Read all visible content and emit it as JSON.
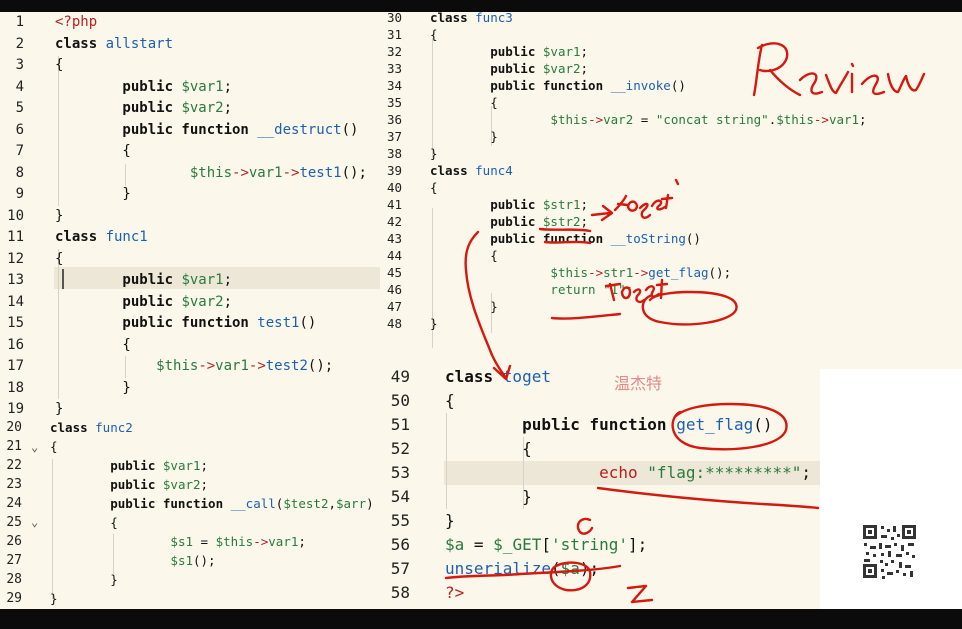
{
  "editor": {
    "panel1": {
      "lines": [
        {
          "n": "1",
          "tokens": [
            {
              "t": "<?php",
              "c": "tag"
            }
          ]
        },
        {
          "n": "2",
          "tokens": [
            {
              "t": "class ",
              "c": "kw"
            },
            {
              "t": "allstart",
              "c": "cls"
            }
          ]
        },
        {
          "n": "3",
          "tokens": [
            {
              "t": "{",
              "c": "plain"
            }
          ]
        },
        {
          "n": "4",
          "tokens": [
            {
              "t": "        public ",
              "c": "kw"
            },
            {
              "t": "$var1",
              "c": "var"
            },
            {
              "t": ";",
              "c": "plain"
            }
          ]
        },
        {
          "n": "5",
          "tokens": [
            {
              "t": "        public ",
              "c": "kw"
            },
            {
              "t": "$var2",
              "c": "var"
            },
            {
              "t": ";",
              "c": "plain"
            }
          ]
        },
        {
          "n": "6",
          "tokens": [
            {
              "t": "        public function ",
              "c": "kw"
            },
            {
              "t": "__destruct",
              "c": "fn"
            },
            {
              "t": "()",
              "c": "plain"
            }
          ]
        },
        {
          "n": "7",
          "tokens": [
            {
              "t": "        {",
              "c": "plain"
            }
          ]
        },
        {
          "n": "8",
          "tokens": [
            {
              "t": "                ",
              "c": "plain"
            },
            {
              "t": "$this",
              "c": "var"
            },
            {
              "t": "->",
              "c": "arrow"
            },
            {
              "t": "var1",
              "c": "var"
            },
            {
              "t": "->",
              "c": "arrow"
            },
            {
              "t": "test1",
              "c": "fn"
            },
            {
              "t": "();",
              "c": "plain"
            }
          ]
        },
        {
          "n": "9",
          "tokens": [
            {
              "t": "        }",
              "c": "plain"
            }
          ]
        },
        {
          "n": "10",
          "tokens": [
            {
              "t": "}",
              "c": "plain"
            }
          ]
        },
        {
          "n": "11",
          "tokens": [
            {
              "t": "class ",
              "c": "kw"
            },
            {
              "t": "func1",
              "c": "cls"
            }
          ]
        },
        {
          "n": "12",
          "tokens": [
            {
              "t": "{",
              "c": "plain"
            }
          ]
        },
        {
          "n": "13",
          "tokens": [
            {
              "t": "        public ",
              "c": "kw"
            },
            {
              "t": "$var1",
              "c": "var"
            },
            {
              "t": ";",
              "c": "plain"
            }
          ]
        },
        {
          "n": "14",
          "tokens": [
            {
              "t": "        public ",
              "c": "kw"
            },
            {
              "t": "$var2",
              "c": "var"
            },
            {
              "t": ";",
              "c": "plain"
            }
          ]
        },
        {
          "n": "15",
          "tokens": [
            {
              "t": "        public function ",
              "c": "kw"
            },
            {
              "t": "test1",
              "c": "fn"
            },
            {
              "t": "()",
              "c": "plain"
            }
          ]
        },
        {
          "n": "16",
          "tokens": [
            {
              "t": "        {",
              "c": "plain"
            }
          ]
        },
        {
          "n": "17",
          "tokens": [
            {
              "t": "            ",
              "c": "plain"
            },
            {
              "t": "$this",
              "c": "var"
            },
            {
              "t": "->",
              "c": "arrow"
            },
            {
              "t": "var1",
              "c": "var"
            },
            {
              "t": "->",
              "c": "arrow"
            },
            {
              "t": "test2",
              "c": "fn"
            },
            {
              "t": "();",
              "c": "plain"
            }
          ]
        },
        {
          "n": "18",
          "tokens": [
            {
              "t": "        }",
              "c": "plain"
            }
          ]
        },
        {
          "n": "19",
          "tokens": [
            {
              "t": "}",
              "c": "plain"
            }
          ]
        }
      ],
      "lines_small": [
        {
          "n": "20",
          "tokens": [
            {
              "t": "class ",
              "c": "kw"
            },
            {
              "t": "func2",
              "c": "cls"
            }
          ]
        },
        {
          "n": "21",
          "tokens": [
            {
              "t": "{",
              "c": "plain"
            }
          ]
        },
        {
          "n": "22",
          "tokens": [
            {
              "t": "        public ",
              "c": "kw"
            },
            {
              "t": "$var1",
              "c": "var"
            },
            {
              "t": ";",
              "c": "plain"
            }
          ]
        },
        {
          "n": "23",
          "tokens": [
            {
              "t": "        public ",
              "c": "kw"
            },
            {
              "t": "$var2",
              "c": "var"
            },
            {
              "t": ";",
              "c": "plain"
            }
          ]
        },
        {
          "n": "24",
          "tokens": [
            {
              "t": "        public function ",
              "c": "kw"
            },
            {
              "t": "__call",
              "c": "fn"
            },
            {
              "t": "(",
              "c": "plain"
            },
            {
              "t": "$test2",
              "c": "var"
            },
            {
              "t": ",",
              "c": "plain"
            },
            {
              "t": "$arr",
              "c": "var"
            },
            {
              "t": ")",
              "c": "plain"
            }
          ]
        },
        {
          "n": "25",
          "tokens": [
            {
              "t": "        {",
              "c": "plain"
            }
          ]
        },
        {
          "n": "26",
          "tokens": [
            {
              "t": "                ",
              "c": "plain"
            },
            {
              "t": "$s1",
              "c": "var"
            },
            {
              "t": " = ",
              "c": "plain"
            },
            {
              "t": "$this",
              "c": "var"
            },
            {
              "t": "->",
              "c": "arrow"
            },
            {
              "t": "var1",
              "c": "var"
            },
            {
              "t": ";",
              "c": "plain"
            }
          ]
        },
        {
          "n": "27",
          "tokens": [
            {
              "t": "                ",
              "c": "plain"
            },
            {
              "t": "$s1",
              "c": "var"
            },
            {
              "t": "();",
              "c": "plain"
            }
          ]
        },
        {
          "n": "28",
          "tokens": [
            {
              "t": "        }",
              "c": "plain"
            }
          ]
        },
        {
          "n": "29",
          "tokens": [
            {
              "t": "}",
              "c": "plain"
            }
          ]
        }
      ]
    },
    "panel2": {
      "lines": [
        {
          "n": "30",
          "tokens": [
            {
              "t": "class ",
              "c": "kw"
            },
            {
              "t": "func3",
              "c": "cls"
            }
          ]
        },
        {
          "n": "31",
          "tokens": [
            {
              "t": "{",
              "c": "plain"
            }
          ]
        },
        {
          "n": "32",
          "tokens": [
            {
              "t": "        public ",
              "c": "kw"
            },
            {
              "t": "$var1",
              "c": "var"
            },
            {
              "t": ";",
              "c": "plain"
            }
          ]
        },
        {
          "n": "33",
          "tokens": [
            {
              "t": "        public ",
              "c": "kw"
            },
            {
              "t": "$var2",
              "c": "var"
            },
            {
              "t": ";",
              "c": "plain"
            }
          ]
        },
        {
          "n": "34",
          "tokens": [
            {
              "t": "        public function ",
              "c": "kw"
            },
            {
              "t": "__invoke",
              "c": "fn"
            },
            {
              "t": "()",
              "c": "plain"
            }
          ]
        },
        {
          "n": "35",
          "tokens": [
            {
              "t": "        {",
              "c": "plain"
            }
          ]
        },
        {
          "n": "36",
          "tokens": [
            {
              "t": "                ",
              "c": "plain"
            },
            {
              "t": "$this",
              "c": "var"
            },
            {
              "t": "->",
              "c": "arrow"
            },
            {
              "t": "var2",
              "c": "var"
            },
            {
              "t": " = ",
              "c": "plain"
            },
            {
              "t": "\"concat string\"",
              "c": "str"
            },
            {
              "t": ".",
              "c": "plain"
            },
            {
              "t": "$this",
              "c": "var"
            },
            {
              "t": "->",
              "c": "arrow"
            },
            {
              "t": "var1",
              "c": "var"
            },
            {
              "t": ";",
              "c": "plain"
            }
          ]
        },
        {
          "n": "37",
          "tokens": [
            {
              "t": "        }",
              "c": "plain"
            }
          ]
        },
        {
          "n": "38",
          "tokens": [
            {
              "t": "}",
              "c": "plain"
            }
          ]
        },
        {
          "n": "39",
          "tokens": [
            {
              "t": "class ",
              "c": "kw"
            },
            {
              "t": "func4",
              "c": "cls"
            }
          ]
        },
        {
          "n": "40",
          "tokens": [
            {
              "t": "{",
              "c": "plain"
            }
          ]
        },
        {
          "n": "41",
          "tokens": [
            {
              "t": "        public ",
              "c": "kw"
            },
            {
              "t": "$str1",
              "c": "var"
            },
            {
              "t": ";",
              "c": "plain"
            }
          ]
        },
        {
          "n": "42",
          "tokens": [
            {
              "t": "        public ",
              "c": "kw"
            },
            {
              "t": "$str2",
              "c": "var"
            },
            {
              "t": ";",
              "c": "plain"
            }
          ]
        },
        {
          "n": "43",
          "tokens": [
            {
              "t": "        public function ",
              "c": "kw"
            },
            {
              "t": "__toString",
              "c": "fn"
            },
            {
              "t": "()",
              "c": "plain"
            }
          ]
        },
        {
          "n": "44",
          "tokens": [
            {
              "t": "        {",
              "c": "plain"
            }
          ]
        },
        {
          "n": "45",
          "tokens": [
            {
              "t": "                ",
              "c": "plain"
            },
            {
              "t": "$this",
              "c": "var"
            },
            {
              "t": "->",
              "c": "arrow"
            },
            {
              "t": "str1",
              "c": "var"
            },
            {
              "t": "->",
              "c": "arrow"
            },
            {
              "t": "get_flag",
              "c": "fn"
            },
            {
              "t": "();",
              "c": "plain"
            }
          ]
        },
        {
          "n": "46",
          "tokens": [
            {
              "t": "                ",
              "c": "plain"
            },
            {
              "t": "return ",
              "c": "str"
            },
            {
              "t": "\"1\"",
              "c": "str"
            },
            {
              "t": ";",
              "c": "plain"
            }
          ]
        },
        {
          "n": "47",
          "tokens": [
            {
              "t": "        }",
              "c": "plain"
            }
          ]
        },
        {
          "n": "48",
          "tokens": [
            {
              "t": "}",
              "c": "plain"
            }
          ]
        }
      ]
    },
    "panel3": {
      "lines": [
        {
          "n": "49",
          "tokens": [
            {
              "t": "class ",
              "c": "kw"
            },
            {
              "t": "toget",
              "c": "cls"
            }
          ]
        },
        {
          "n": "50",
          "tokens": [
            {
              "t": "{",
              "c": "plain"
            }
          ]
        },
        {
          "n": "51",
          "tokens": [
            {
              "t": "        public function ",
              "c": "kw"
            },
            {
              "t": "get_flag",
              "c": "fn"
            },
            {
              "t": "()",
              "c": "plain"
            }
          ]
        },
        {
          "n": "52",
          "tokens": [
            {
              "t": "        {",
              "c": "plain"
            }
          ]
        },
        {
          "n": "53",
          "tokens": [
            {
              "t": "                ",
              "c": "plain"
            },
            {
              "t": "echo ",
              "c": "tag"
            },
            {
              "t": "\"flag:*********\"",
              "c": "str"
            },
            {
              "t": ";",
              "c": "plain"
            }
          ]
        },
        {
          "n": "54",
          "tokens": [
            {
              "t": "        }",
              "c": "plain"
            }
          ]
        },
        {
          "n": "55",
          "tokens": [
            {
              "t": "}",
              "c": "plain"
            }
          ]
        },
        {
          "n": "56",
          "tokens": [
            {
              "t": "$a",
              "c": "var"
            },
            {
              "t": " = ",
              "c": "plain"
            },
            {
              "t": "$_GET",
              "c": "var"
            },
            {
              "t": "[",
              "c": "plain"
            },
            {
              "t": "'string'",
              "c": "str"
            },
            {
              "t": "];",
              "c": "plain"
            }
          ]
        },
        {
          "n": "57",
          "tokens": [
            {
              "t": "unserialize",
              "c": "fn"
            },
            {
              "t": "(",
              "c": "plain"
            },
            {
              "t": "$a",
              "c": "var"
            },
            {
              "t": ");",
              "c": "plain"
            }
          ]
        },
        {
          "n": "58",
          "tokens": [
            {
              "t": "?>",
              "c": "tag"
            }
          ]
        }
      ]
    }
  },
  "annotations": {
    "review": "Review",
    "toget_1": "toget",
    "toget_2": "toget",
    "chinese": "温杰特",
    "ink_color": "#d4190f"
  },
  "colors": {
    "background": "#fbf7ea",
    "keyword": "#111111",
    "class_name": "#1d5fae",
    "variable": "#2b7a3d",
    "php_tag": "#b81f1f"
  },
  "qr_icon": "qr-code-icon"
}
